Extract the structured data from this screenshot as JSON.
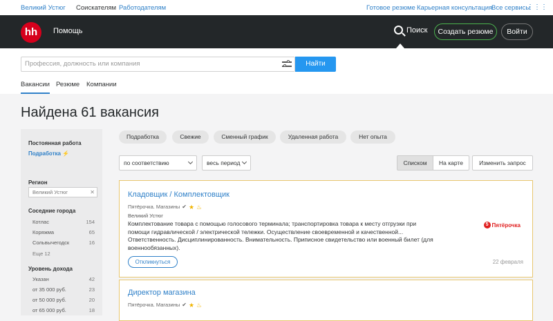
{
  "topbar": {
    "city": "Великий Устюг",
    "seekers": "Соискателям",
    "employers": "Работодателям",
    "ready_resume": "Готовое резюме",
    "career": "Карьерная консультация",
    "all_services": "Все сервисы"
  },
  "header": {
    "logo": "hh",
    "help": "Помощь",
    "search": "Поиск",
    "create_resume": "Создать резюме",
    "login": "Войти"
  },
  "search": {
    "placeholder": "Профессия, должность или компания",
    "button": "Найти",
    "tabs": [
      "Вакансии",
      "Резюме",
      "Компании"
    ]
  },
  "page_title": "Найдена 61 вакансия",
  "sidebar": {
    "employment_header": "Постоянная работа",
    "employment_item": "Подработка ⚡",
    "region_header": "Регион",
    "region_value": "Великий Устюг",
    "nearby_header": "Соседние города",
    "nearby": [
      {
        "name": "Котлас",
        "count": "154"
      },
      {
        "name": "Коряжма",
        "count": "65"
      },
      {
        "name": "Сольвычегодск",
        "count": "16"
      }
    ],
    "more": "Еще 12",
    "income_header": "Уровень дохода",
    "income": [
      {
        "name": "Указан",
        "count": "42"
      },
      {
        "name": "от 35 000 руб.",
        "count": "23"
      },
      {
        "name": "от 50 000 руб.",
        "count": "20"
      },
      {
        "name": "от 65 000 руб.",
        "count": "18"
      }
    ]
  },
  "chips": [
    "Подработка",
    "Свежие",
    "Сменный график",
    "Удаленная работа",
    "Нет опыта"
  ],
  "controls": {
    "sort": "по соответствию",
    "period": "весь период",
    "list": "Списком",
    "map": "На карте",
    "change": "Изменить запрос"
  },
  "vacancies": [
    {
      "title": "Кладовщик / Комплектовщик",
      "company": "Пятёрочка. Магазины",
      "city": "Великий Устюг",
      "description": "Комплектование товара с помощью голосового терминала; транспортировка товара к месту отгрузки при помощи гидравлической / электрической тележки. Осуществление своевременной и качественной... Ответственность. Дисциплинированность. Внимательность. Приписное свидетельство или военный билет (для военнообязанных).",
      "respond": "Откликнуться",
      "date": "22 февраля",
      "brand": "Пятёрочка"
    },
    {
      "title": "Директор магазина",
      "company": "Пятёрочка. Магазины"
    }
  ],
  "colors": {
    "accent": "#2f80c8",
    "header_bg": "#232729",
    "logo_red": "#d6001c",
    "find_button": "#2597f0"
  }
}
